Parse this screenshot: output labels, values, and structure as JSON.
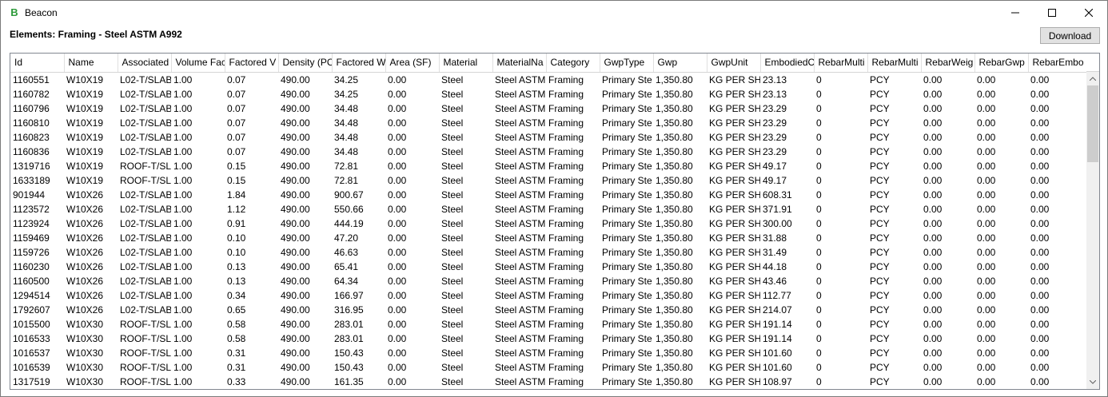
{
  "window": {
    "title": "Beacon",
    "app_icon_letter": "B",
    "accent_color": "#2e9a3a"
  },
  "header": {
    "title": "Elements: Framing - Steel ASTM A992",
    "download_label": "Download"
  },
  "table": {
    "columns": [
      "Id",
      "Name",
      "Associated",
      "Volume Fac",
      "Factored V",
      "Density (PC",
      "Factored W",
      "Area (SF)",
      "Material",
      "MaterialNa",
      "Category",
      "GwpType",
      "Gwp",
      "GwpUnit",
      "EmbodiedC",
      "RebarMulti",
      "RebarMulti",
      "RebarWeig",
      "RebarGwp",
      "RebarEmbo"
    ],
    "rows": [
      [
        "1160551",
        "W10X19",
        "L02-T/SLAB",
        "1.00",
        "0.07",
        "490.00",
        "34.25",
        "0.00",
        "Steel",
        "Steel ASTM",
        "Framing",
        "Primary Ste",
        "1,350.80",
        "KG PER SHC",
        "23.13",
        "0",
        "PCY",
        "0.00",
        "0.00",
        "0.00"
      ],
      [
        "1160782",
        "W10X19",
        "L02-T/SLAB",
        "1.00",
        "0.07",
        "490.00",
        "34.25",
        "0.00",
        "Steel",
        "Steel ASTM",
        "Framing",
        "Primary Ste",
        "1,350.80",
        "KG PER SHC",
        "23.13",
        "0",
        "PCY",
        "0.00",
        "0.00",
        "0.00"
      ],
      [
        "1160796",
        "W10X19",
        "L02-T/SLAB",
        "1.00",
        "0.07",
        "490.00",
        "34.48",
        "0.00",
        "Steel",
        "Steel ASTM",
        "Framing",
        "Primary Ste",
        "1,350.80",
        "KG PER SHC",
        "23.29",
        "0",
        "PCY",
        "0.00",
        "0.00",
        "0.00"
      ],
      [
        "1160810",
        "W10X19",
        "L02-T/SLAB",
        "1.00",
        "0.07",
        "490.00",
        "34.48",
        "0.00",
        "Steel",
        "Steel ASTM",
        "Framing",
        "Primary Ste",
        "1,350.80",
        "KG PER SHC",
        "23.29",
        "0",
        "PCY",
        "0.00",
        "0.00",
        "0.00"
      ],
      [
        "1160823",
        "W10X19",
        "L02-T/SLAB",
        "1.00",
        "0.07",
        "490.00",
        "34.48",
        "0.00",
        "Steel",
        "Steel ASTM",
        "Framing",
        "Primary Ste",
        "1,350.80",
        "KG PER SHC",
        "23.29",
        "0",
        "PCY",
        "0.00",
        "0.00",
        "0.00"
      ],
      [
        "1160836",
        "W10X19",
        "L02-T/SLAB",
        "1.00",
        "0.07",
        "490.00",
        "34.48",
        "0.00",
        "Steel",
        "Steel ASTM",
        "Framing",
        "Primary Ste",
        "1,350.80",
        "KG PER SHC",
        "23.29",
        "0",
        "PCY",
        "0.00",
        "0.00",
        "0.00"
      ],
      [
        "1319716",
        "W10X19",
        "ROOF-T/SL/",
        "1.00",
        "0.15",
        "490.00",
        "72.81",
        "0.00",
        "Steel",
        "Steel ASTM",
        "Framing",
        "Primary Ste",
        "1,350.80",
        "KG PER SHC",
        "49.17",
        "0",
        "PCY",
        "0.00",
        "0.00",
        "0.00"
      ],
      [
        "1633189",
        "W10X19",
        "ROOF-T/SL/",
        "1.00",
        "0.15",
        "490.00",
        "72.81",
        "0.00",
        "Steel",
        "Steel ASTM",
        "Framing",
        "Primary Ste",
        "1,350.80",
        "KG PER SHC",
        "49.17",
        "0",
        "PCY",
        "0.00",
        "0.00",
        "0.00"
      ],
      [
        "901944",
        "W10X26",
        "L02-T/SLAB",
        "1.00",
        "1.84",
        "490.00",
        "900.67",
        "0.00",
        "Steel",
        "Steel ASTM",
        "Framing",
        "Primary Ste",
        "1,350.80",
        "KG PER SHC",
        "608.31",
        "0",
        "PCY",
        "0.00",
        "0.00",
        "0.00"
      ],
      [
        "1123572",
        "W10X26",
        "L02-T/SLAB",
        "1.00",
        "1.12",
        "490.00",
        "550.66",
        "0.00",
        "Steel",
        "Steel ASTM",
        "Framing",
        "Primary Ste",
        "1,350.80",
        "KG PER SHC",
        "371.91",
        "0",
        "PCY",
        "0.00",
        "0.00",
        "0.00"
      ],
      [
        "1123924",
        "W10X26",
        "L02-T/SLAB",
        "1.00",
        "0.91",
        "490.00",
        "444.19",
        "0.00",
        "Steel",
        "Steel ASTM",
        "Framing",
        "Primary Ste",
        "1,350.80",
        "KG PER SHC",
        "300.00",
        "0",
        "PCY",
        "0.00",
        "0.00",
        "0.00"
      ],
      [
        "1159469",
        "W10X26",
        "L02-T/SLAB",
        "1.00",
        "0.10",
        "490.00",
        "47.20",
        "0.00",
        "Steel",
        "Steel ASTM",
        "Framing",
        "Primary Ste",
        "1,350.80",
        "KG PER SHC",
        "31.88",
        "0",
        "PCY",
        "0.00",
        "0.00",
        "0.00"
      ],
      [
        "1159726",
        "W10X26",
        "L02-T/SLAB",
        "1.00",
        "0.10",
        "490.00",
        "46.63",
        "0.00",
        "Steel",
        "Steel ASTM",
        "Framing",
        "Primary Ste",
        "1,350.80",
        "KG PER SHC",
        "31.49",
        "0",
        "PCY",
        "0.00",
        "0.00",
        "0.00"
      ],
      [
        "1160230",
        "W10X26",
        "L02-T/SLAB",
        "1.00",
        "0.13",
        "490.00",
        "65.41",
        "0.00",
        "Steel",
        "Steel ASTM",
        "Framing",
        "Primary Ste",
        "1,350.80",
        "KG PER SHC",
        "44.18",
        "0",
        "PCY",
        "0.00",
        "0.00",
        "0.00"
      ],
      [
        "1160500",
        "W10X26",
        "L02-T/SLAB",
        "1.00",
        "0.13",
        "490.00",
        "64.34",
        "0.00",
        "Steel",
        "Steel ASTM",
        "Framing",
        "Primary Ste",
        "1,350.80",
        "KG PER SHC",
        "43.46",
        "0",
        "PCY",
        "0.00",
        "0.00",
        "0.00"
      ],
      [
        "1294514",
        "W10X26",
        "L02-T/SLAB",
        "1.00",
        "0.34",
        "490.00",
        "166.97",
        "0.00",
        "Steel",
        "Steel ASTM",
        "Framing",
        "Primary Ste",
        "1,350.80",
        "KG PER SHC",
        "112.77",
        "0",
        "PCY",
        "0.00",
        "0.00",
        "0.00"
      ],
      [
        "1792607",
        "W10X26",
        "L02-T/SLAB",
        "1.00",
        "0.65",
        "490.00",
        "316.95",
        "0.00",
        "Steel",
        "Steel ASTM",
        "Framing",
        "Primary Ste",
        "1,350.80",
        "KG PER SHC",
        "214.07",
        "0",
        "PCY",
        "0.00",
        "0.00",
        "0.00"
      ],
      [
        "1015500",
        "W10X30",
        "ROOF-T/SL/",
        "1.00",
        "0.58",
        "490.00",
        "283.01",
        "0.00",
        "Steel",
        "Steel ASTM",
        "Framing",
        "Primary Ste",
        "1,350.80",
        "KG PER SHC",
        "191.14",
        "0",
        "PCY",
        "0.00",
        "0.00",
        "0.00"
      ],
      [
        "1016533",
        "W10X30",
        "ROOF-T/SL/",
        "1.00",
        "0.58",
        "490.00",
        "283.01",
        "0.00",
        "Steel",
        "Steel ASTM",
        "Framing",
        "Primary Ste",
        "1,350.80",
        "KG PER SHC",
        "191.14",
        "0",
        "PCY",
        "0.00",
        "0.00",
        "0.00"
      ],
      [
        "1016537",
        "W10X30",
        "ROOF-T/SL/",
        "1.00",
        "0.31",
        "490.00",
        "150.43",
        "0.00",
        "Steel",
        "Steel ASTM",
        "Framing",
        "Primary Ste",
        "1,350.80",
        "KG PER SHC",
        "101.60",
        "0",
        "PCY",
        "0.00",
        "0.00",
        "0.00"
      ],
      [
        "1016539",
        "W10X30",
        "ROOF-T/SL/",
        "1.00",
        "0.31",
        "490.00",
        "150.43",
        "0.00",
        "Steel",
        "Steel ASTM",
        "Framing",
        "Primary Ste",
        "1,350.80",
        "KG PER SHC",
        "101.60",
        "0",
        "PCY",
        "0.00",
        "0.00",
        "0.00"
      ],
      [
        "1317519",
        "W10X30",
        "ROOF-T/SL/",
        "1.00",
        "0.33",
        "490.00",
        "161.35",
        "0.00",
        "Steel",
        "Steel ASTM",
        "Framing",
        "Primary Ste",
        "1,350.80",
        "KG PER SHC",
        "108.97",
        "0",
        "PCY",
        "0.00",
        "0.00",
        "0.00"
      ]
    ]
  }
}
